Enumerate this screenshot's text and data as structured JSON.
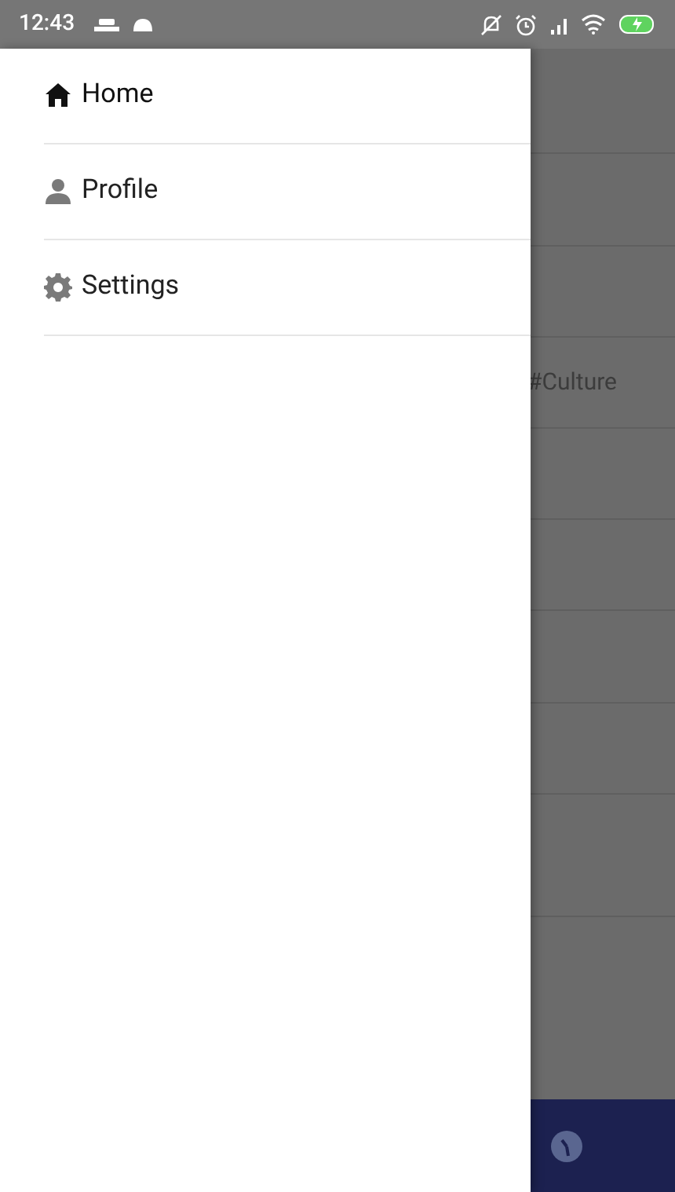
{
  "status_bar": {
    "time": "12:43"
  },
  "drawer": {
    "items": [
      {
        "label": "Home",
        "kind": "home",
        "selected": true
      },
      {
        "label": "Profile",
        "kind": "profile",
        "selected": false
      },
      {
        "label": "Settings",
        "kind": "settings",
        "selected": false
      }
    ]
  },
  "background_list": {
    "tag": "#Culture"
  }
}
